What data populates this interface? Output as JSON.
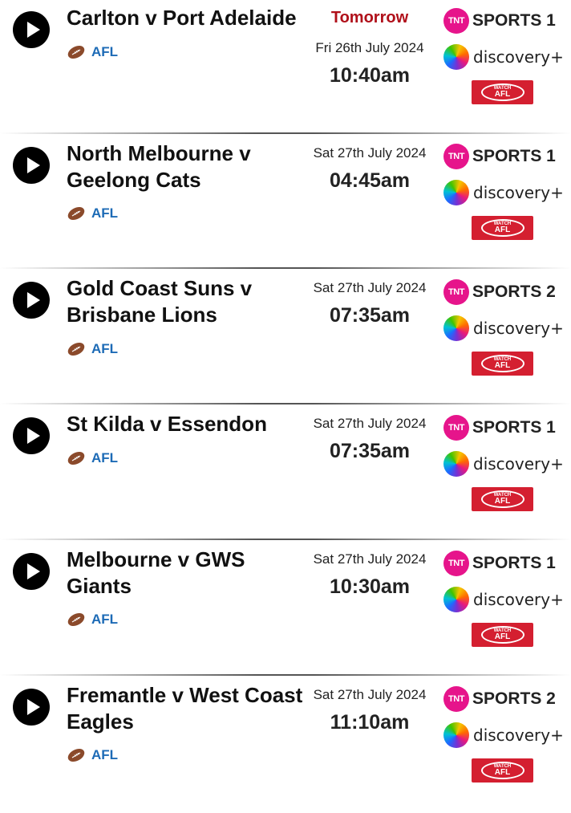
{
  "fixtures": [
    {
      "title": "Carlton v Port Adelaide",
      "sport": "AFL",
      "day_label": "Tomorrow",
      "date": "Fri 26th July 2024",
      "time": "10:40am",
      "tnt_channel": "SPORTS 1",
      "stream": "discovery+",
      "afl_badge": "WATCH AFL"
    },
    {
      "title": "North Melbourne v Geelong Cats",
      "sport": "AFL",
      "day_label": "",
      "date": "Sat 27th July 2024",
      "time": "04:45am",
      "tnt_channel": "SPORTS 1",
      "stream": "discovery+",
      "afl_badge": "WATCH AFL"
    },
    {
      "title": "Gold Coast Suns v Brisbane Lions",
      "sport": "AFL",
      "day_label": "",
      "date": "Sat 27th July 2024",
      "time": "07:35am",
      "tnt_channel": "SPORTS 2",
      "stream": "discovery+",
      "afl_badge": "WATCH AFL"
    },
    {
      "title": "St Kilda v Essendon",
      "sport": "AFL",
      "day_label": "",
      "date": "Sat 27th July 2024",
      "time": "07:35am",
      "tnt_channel": "SPORTS 1",
      "stream": "discovery+",
      "afl_badge": "WATCH AFL"
    },
    {
      "title": "Melbourne v GWS Giants",
      "sport": "AFL",
      "day_label": "",
      "date": "Sat 27th July 2024",
      "time": "10:30am",
      "tnt_channel": "SPORTS 1",
      "stream": "discovery+",
      "afl_badge": "WATCH AFL"
    },
    {
      "title": "Fremantle v West Coast Eagles",
      "sport": "AFL",
      "day_label": "",
      "date": "Sat 27th July 2024",
      "time": "11:10am",
      "tnt_channel": "SPORTS 2",
      "stream": "discovery+",
      "afl_badge": "WATCH AFL"
    }
  ],
  "brand": {
    "tnt_badge": "TNT",
    "tomorrow_color": "#b0101a",
    "sport_color": "#1d6bb6",
    "afl_red": "#d41f30",
    "tnt_pink": "#e6148b"
  },
  "icons": {
    "play": "play-icon",
    "sport": "football-icon"
  }
}
